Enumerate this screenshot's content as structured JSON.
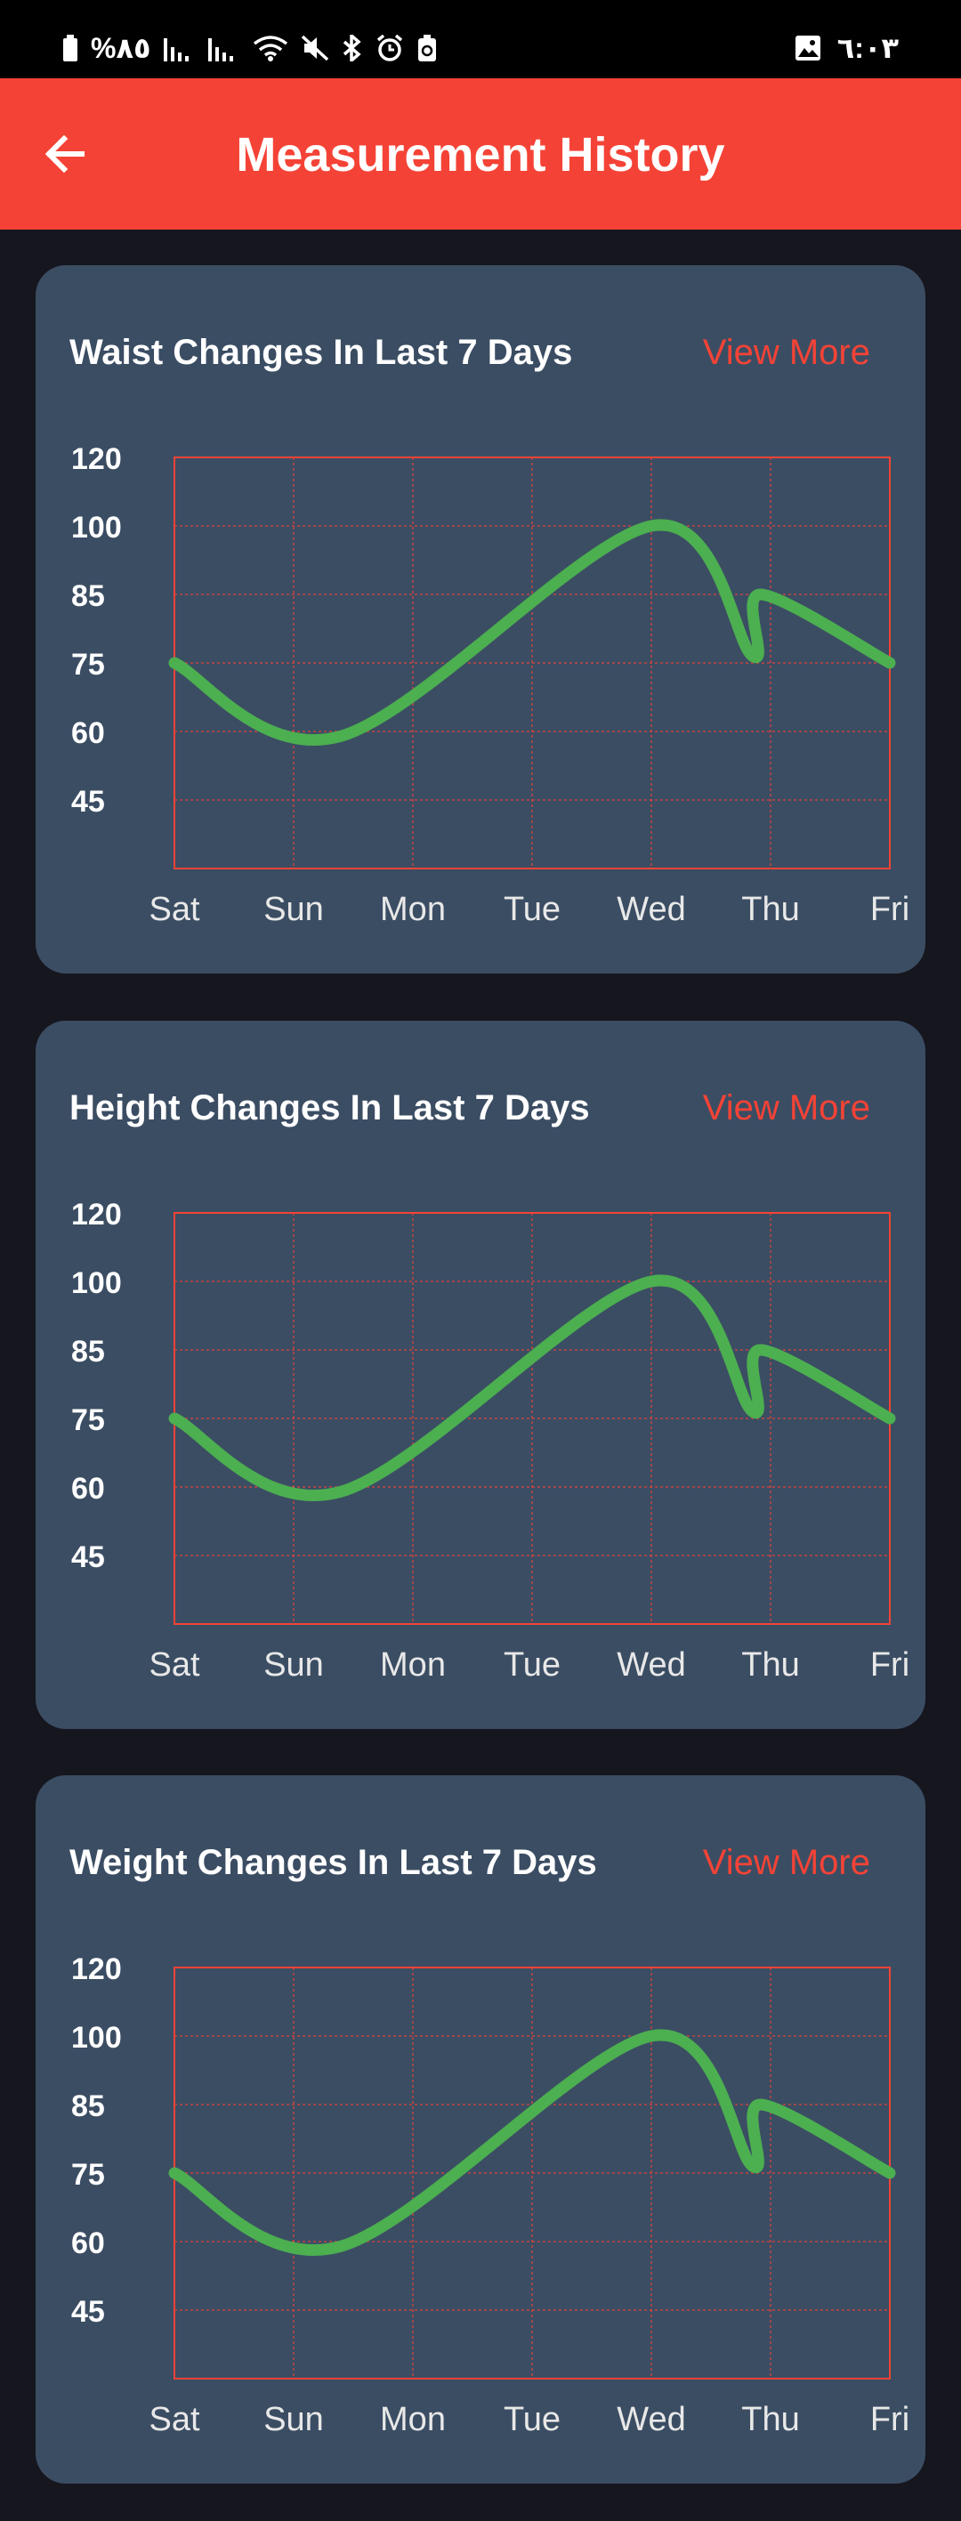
{
  "status_bar": {
    "battery_text": "%٨٥",
    "time": "٦:٠٣"
  },
  "app_bar": {
    "title": "Measurement History"
  },
  "accent_color": "#f44336",
  "line_color": "#4caf50",
  "cards": [
    {
      "title": "Waist Changes In Last 7 Days",
      "link": "View More"
    },
    {
      "title": "Height Changes In Last 7 Days",
      "link": "View More"
    },
    {
      "title": "Weight Changes In Last 7 Days",
      "link": "View More"
    }
  ],
  "chart_data": [
    {
      "type": "line",
      "categories": [
        "Sat",
        "Sun",
        "Mon",
        "Tue",
        "Wed",
        "Thu",
        "Fri"
      ],
      "yticks": [
        45,
        60,
        75,
        85,
        100,
        120
      ],
      "grid": true,
      "series": [
        {
          "x": [
            0,
            1.4,
            4,
            4.85,
            4.92,
            6
          ],
          "values": [
            75,
            59,
            100,
            76,
            85,
            75
          ]
        }
      ]
    },
    {
      "type": "line",
      "categories": [
        "Sat",
        "Sun",
        "Mon",
        "Tue",
        "Wed",
        "Thu",
        "Fri"
      ],
      "yticks": [
        45,
        60,
        75,
        85,
        100,
        120
      ],
      "grid": true,
      "series": [
        {
          "x": [
            0,
            1.4,
            4,
            4.85,
            4.92,
            6
          ],
          "values": [
            75,
            59,
            100,
            76,
            85,
            75
          ]
        }
      ]
    },
    {
      "type": "line",
      "categories": [
        "Sat",
        "Sun",
        "Mon",
        "Tue",
        "Wed",
        "Thu",
        "Fri"
      ],
      "yticks": [
        45,
        60,
        75,
        85,
        100,
        120
      ],
      "grid": true,
      "series": [
        {
          "x": [
            0,
            1.4,
            4,
            4.85,
            4.92,
            6
          ],
          "values": [
            75,
            59,
            100,
            76,
            85,
            75
          ]
        }
      ]
    }
  ]
}
